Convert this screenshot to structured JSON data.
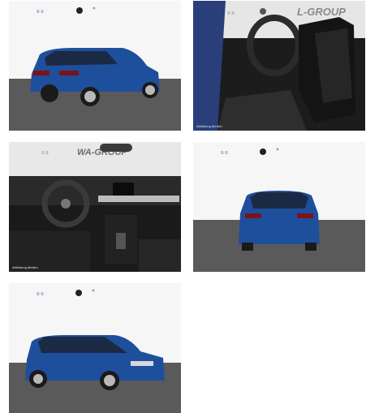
{
  "gallery": {
    "tiles": [
      {
        "id": "rear-three-quarter",
        "caption": ""
      },
      {
        "id": "front-seats",
        "caption": "Abbildung ähnlich.",
        "dealer_text": "L-GROUP"
      },
      {
        "id": "dashboard",
        "caption": "Abbildung ähnlich.",
        "dealer_text": "WA-GROUP"
      },
      {
        "id": "rear-view",
        "caption": ""
      },
      {
        "id": "front-three-quarter",
        "caption": ""
      }
    ]
  },
  "colors": {
    "car_blue": "#1e4f9c",
    "floor_grey": "#555555",
    "wall_white": "#f4f4f4",
    "interior_dark": "#1c1c1c"
  }
}
